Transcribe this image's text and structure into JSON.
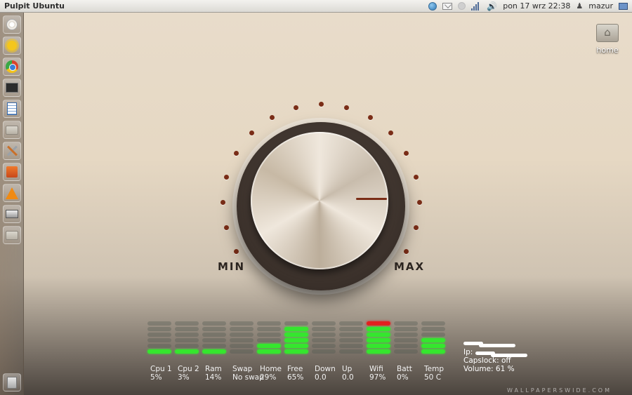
{
  "panel": {
    "title": "Pulpit Ubuntu",
    "datetime": "pon 17 wrz 22:38",
    "username": "mazur"
  },
  "launcher": {
    "items": [
      {
        "icon": "dash-icon"
      },
      {
        "icon": "weather-sun-icon"
      },
      {
        "icon": "chrome-icon"
      },
      {
        "icon": "terminal-icon"
      },
      {
        "icon": "text-document-icon"
      },
      {
        "icon": "folder-icon"
      },
      {
        "icon": "system-tools-icon"
      },
      {
        "icon": "software-center-icon"
      },
      {
        "icon": "vlc-icon"
      },
      {
        "icon": "scanner-icon"
      },
      {
        "icon": "folder-icon"
      }
    ],
    "trash_icon": "trash-icon"
  },
  "desktop": {
    "home_label": "home"
  },
  "knob": {
    "min_label": "MIN",
    "max_label": "MAX",
    "indicator_color": "#7a2d17"
  },
  "meters": [
    {
      "label": "Cpu 1",
      "value": "5%",
      "lit": 1,
      "red": false
    },
    {
      "label": "Cpu 2",
      "value": "3%",
      "lit": 1,
      "red": false
    },
    {
      "label": "Ram",
      "value": "14%",
      "lit": 1,
      "red": false
    },
    {
      "label": "Swap",
      "value": "No swap",
      "lit": 0,
      "red": false
    },
    {
      "label": "Home",
      "value": "29%",
      "lit": 2,
      "red": false
    },
    {
      "label": "Free",
      "value": "65%",
      "lit": 5,
      "red": false
    },
    {
      "label": "Down",
      "value": "0.0",
      "lit": 0,
      "red": false
    },
    {
      "label": "Up",
      "value": "0.0",
      "lit": 0,
      "red": false
    },
    {
      "label": "Wifi",
      "value": "97%",
      "lit": 5,
      "red": true
    },
    {
      "label": "Batt",
      "value": "0%",
      "lit": 0,
      "red": false
    },
    {
      "label": "Temp",
      "value": "50 C",
      "lit": 3,
      "red": false
    }
  ],
  "info": {
    "ip_label": "Ip:",
    "capslock": "Capslock:  off",
    "volume": "Volume:   61 %"
  },
  "watermark": "WALLPAPERSWIDE.COM",
  "colors": {
    "meter_on": "#35e62e",
    "meter_peak": "#e22020"
  }
}
